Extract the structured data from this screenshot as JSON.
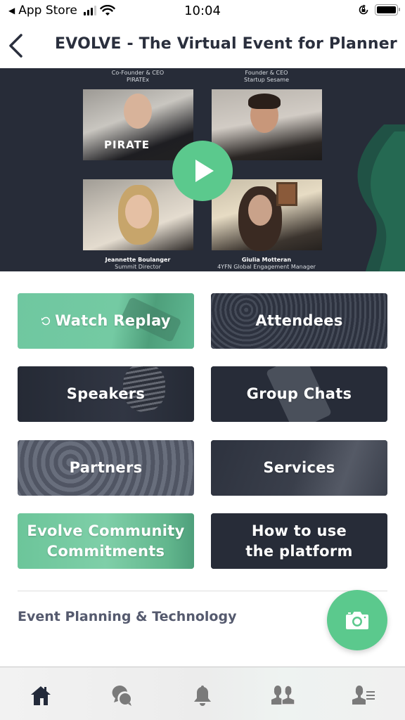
{
  "status_bar": {
    "back_app": "App Store",
    "time": "10:04",
    "icons": [
      "back-arrow-icon",
      "cellular-signal-icon",
      "wifi-icon",
      "rotation-lock-icon",
      "battery-icon"
    ],
    "battery_level": 1.0
  },
  "nav": {
    "back_icon": "chevron-left-icon",
    "title": "EVOLVE - The Virtual Event for Planners b..."
  },
  "video": {
    "play_icon": "play-icon",
    "speakers": [
      {
        "name": "",
        "role": "Co-Founder & CEO",
        "org": "PIRATEx"
      },
      {
        "name": "",
        "role": "Founder & CEO",
        "org": "Startup Sesame"
      },
      {
        "name": "Jeannette Boulanger",
        "role": "Summit Director",
        "org": ""
      },
      {
        "name": "Giulia Motteran",
        "role": "4YFN Global Engagement Manager",
        "org": ""
      }
    ],
    "shirt_text": "PIRATE"
  },
  "menu": {
    "items": [
      {
        "label": "Watch Replay",
        "icon": "replay-icon",
        "style": "green"
      },
      {
        "label": "Attendees",
        "style": "dark"
      },
      {
        "label": "Speakers",
        "style": "dark"
      },
      {
        "label": "Group Chats",
        "style": "dark"
      },
      {
        "label": "Partners",
        "style": "gray"
      },
      {
        "label": "Services",
        "style": "dark"
      },
      {
        "label_line1": "Evolve Community",
        "label_line2": "Commitments",
        "style": "green"
      },
      {
        "label_line1": "How to use",
        "label_line2": "the platform",
        "style": "dark"
      }
    ]
  },
  "section": {
    "title": "Event Planning & Technology"
  },
  "fab": {
    "icon": "camera-icon"
  },
  "tab_bar": {
    "tabs": [
      {
        "name": "home",
        "icon": "home-icon",
        "active": true
      },
      {
        "name": "chats",
        "icon": "chat-bubbles-icon",
        "active": false
      },
      {
        "name": "notifications",
        "icon": "bell-icon",
        "active": false
      },
      {
        "name": "people",
        "icon": "people-icon",
        "active": false
      },
      {
        "name": "profile",
        "icon": "profile-list-icon",
        "active": false
      }
    ]
  },
  "colors": {
    "accent_green": "#5bc98d",
    "card_green": "#6cc59a",
    "dark_navy": "#272c38",
    "title_text": "#2a2f3d",
    "section_text": "#555a6e",
    "tab_active": "#232a3a",
    "tab_inactive": "#7a7a7a"
  }
}
